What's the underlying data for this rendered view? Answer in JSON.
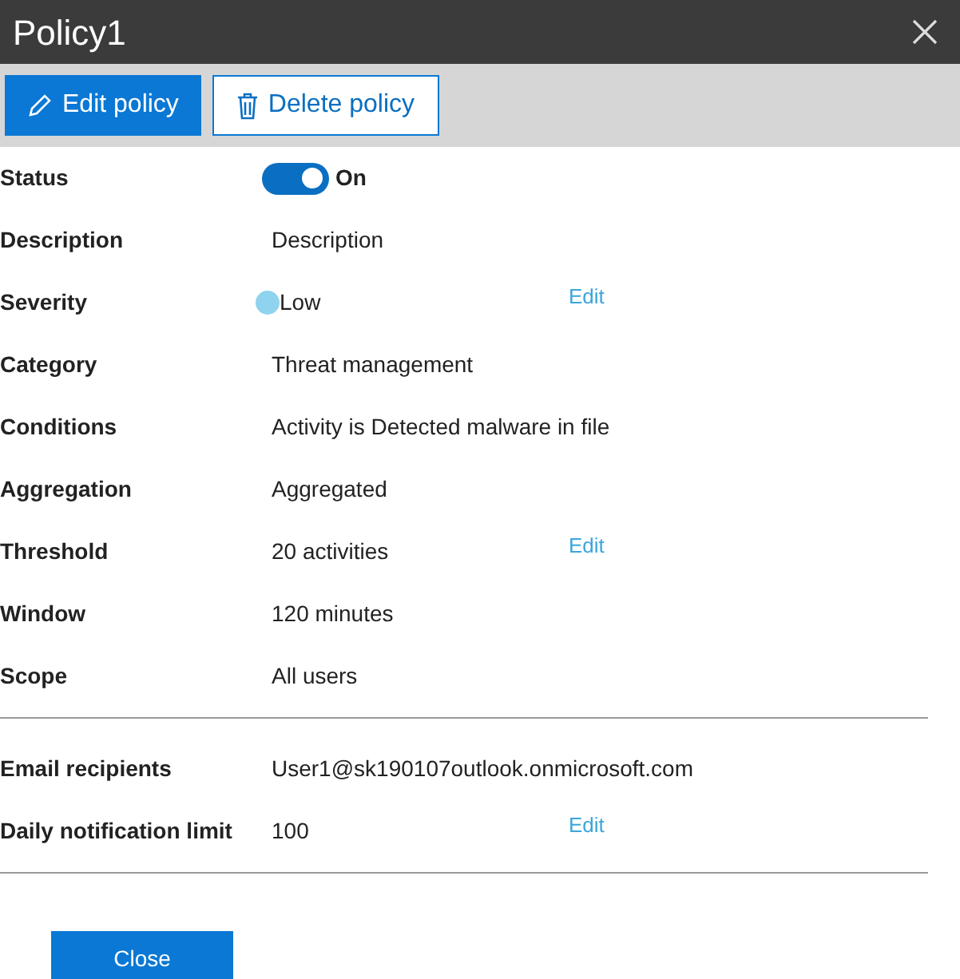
{
  "window": {
    "title": "Policy1"
  },
  "toolbar": [
    {
      "label": "Edit policy",
      "kind": "primary"
    },
    {
      "label": "Delete policy",
      "kind": "secondary"
    }
  ],
  "sections": [
    {
      "rows": [
        {
          "label": "Status",
          "kind": "toggle",
          "on": true,
          "value": "On"
        },
        {
          "label": "Description",
          "kind": "text",
          "value": "Description"
        },
        {
          "label": "Severity",
          "kind": "severity",
          "value": "Low",
          "color": "#8fd3ef",
          "edit": "Edit"
        },
        {
          "label": "Category",
          "kind": "text",
          "value": "Threat management"
        },
        {
          "label": "Conditions",
          "kind": "text",
          "value": "Activity is Detected malware in file"
        },
        {
          "label": "Aggregation",
          "kind": "text",
          "value": "Aggregated"
        },
        {
          "label": "Threshold",
          "kind": "text",
          "value": "20 activities",
          "edit": "Edit"
        },
        {
          "label": "Window",
          "kind": "text",
          "value": "120 minutes"
        },
        {
          "label": "Scope",
          "kind": "text",
          "value": "All users"
        }
      ]
    },
    {
      "rows": [
        {
          "label": "Email recipients",
          "kind": "text",
          "value": "User1@sk190107outlook.onmicrosoft.com"
        },
        {
          "label": "Daily notification limit",
          "kind": "text",
          "value": "100",
          "edit": "Edit"
        }
      ]
    }
  ],
  "footer": {
    "button": "Close"
  }
}
